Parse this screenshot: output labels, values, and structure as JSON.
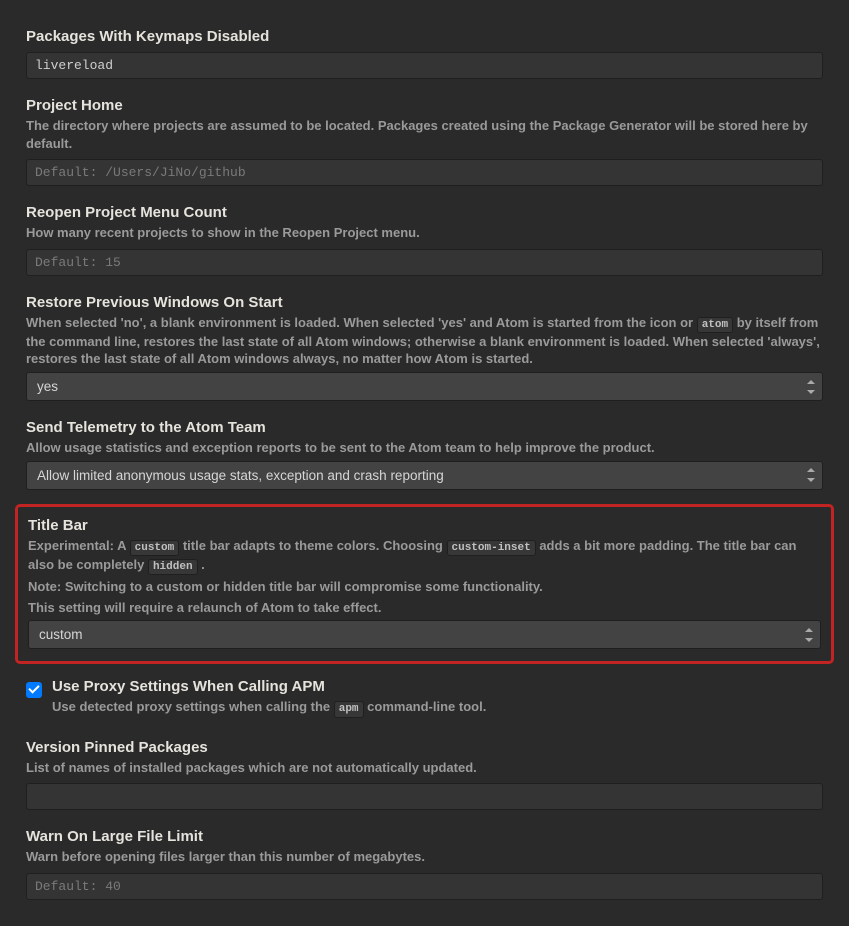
{
  "packagesKeymaps": {
    "title": "Packages With Keymaps Disabled",
    "value": "livereload"
  },
  "projectHome": {
    "title": "Project Home",
    "desc": "The directory where projects are assumed to be located. Packages created using the Package Generator will be stored here by default.",
    "placeholder": "Default: /Users/JiNo/github"
  },
  "reopenCount": {
    "title": "Reopen Project Menu Count",
    "desc": "How many recent projects to show in the Reopen Project menu.",
    "placeholder": "Default: 15"
  },
  "restore": {
    "title": "Restore Previous Windows On Start",
    "desc1": "When selected 'no', a blank environment is loaded. When selected 'yes' and Atom is started from the icon or ",
    "code1": "atom",
    "desc2": " by itself from the command line, restores the last state of all Atom windows; otherwise a blank environment is loaded. When selected 'always', restores the last state of all Atom windows always, no matter how Atom is started.",
    "value": "yes"
  },
  "telemetry": {
    "title": "Send Telemetry to the Atom Team",
    "desc": "Allow usage statistics and exception reports to be sent to the Atom team to help improve the product.",
    "value": "Allow limited anonymous usage stats, exception and crash reporting"
  },
  "titleBar": {
    "title": "Title Bar",
    "d1": "Experimental: A ",
    "c1": "custom",
    "d2": " title bar adapts to theme colors. Choosing ",
    "c2": "custom-inset",
    "d3": " adds a bit more padding. The title bar can also be completely ",
    "c3": "hidden",
    "d4": " .",
    "note1": "Note: Switching to a custom or hidden title bar will compromise some functionality.",
    "note2": "This setting will require a relaunch of Atom to take effect.",
    "value": "custom"
  },
  "proxy": {
    "title": "Use Proxy Settings When Calling APM",
    "d1": "Use detected proxy settings when calling the ",
    "c1": "apm",
    "d2": " command-line tool."
  },
  "versionPinned": {
    "title": "Version Pinned Packages",
    "desc": "List of names of installed packages which are not automatically updated."
  },
  "warnLarge": {
    "title": "Warn On Large File Limit",
    "desc": "Warn before opening files larger than this number of megabytes.",
    "placeholder": "Default: 40"
  }
}
